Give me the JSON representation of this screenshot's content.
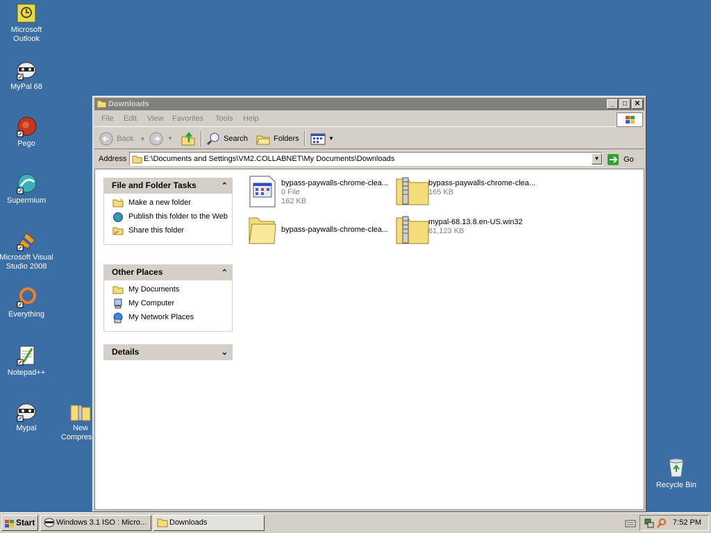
{
  "desktop": {
    "background": "#3a6ea5",
    "icons": [
      {
        "label": "Microsoft Outlook",
        "icon": "outlook-icon"
      },
      {
        "label": "MyPal 68",
        "icon": "mypal-icon"
      },
      {
        "label": "Pego",
        "icon": "pego-icon"
      },
      {
        "label": "Supermium",
        "icon": "supermium-icon"
      },
      {
        "label": "Microsoft Visual Studio 2008",
        "icon": "visual-studio-icon"
      },
      {
        "label": "Everything",
        "icon": "everything-icon"
      },
      {
        "label": "Notepad++",
        "icon": "notepad-plus-plus-icon"
      },
      {
        "label": "Mypal",
        "icon": "mypal-icon"
      },
      {
        "label": "New Compresse",
        "icon": "zip-folder-icon"
      },
      {
        "label": "Recycle Bin",
        "icon": "recycle-bin-icon"
      }
    ]
  },
  "window": {
    "title": "Downloads",
    "menus": [
      "File",
      "Edit",
      "View",
      "Favorites",
      "Tools",
      "Help"
    ],
    "toolbar": {
      "back": "Back",
      "search": "Search",
      "folders": "Folders"
    },
    "address": {
      "label": "Address",
      "value": "E:\\Documents and Settings\\VM2.COLLABNET\\My Documents\\Downloads",
      "go": "Go"
    },
    "panels": {
      "tasks": {
        "title": "File and Folder Tasks",
        "items": [
          "Make a new folder",
          "Publish this folder to the Web",
          "Share this folder"
        ]
      },
      "places": {
        "title": "Other Places",
        "items": [
          "My Documents",
          "My Computer",
          "My Network Places"
        ]
      },
      "details": {
        "title": "Details"
      }
    },
    "files": [
      {
        "name": "bypass-paywalls-chrome-clea...",
        "type": "0 File",
        "size": "162 KB",
        "icon": "file-icon"
      },
      {
        "name": "bypass-paywalls-chrome-clea...",
        "type": "",
        "size": "165 KB",
        "icon": "zip-folder-icon"
      },
      {
        "name": "bypass-paywalls-chrome-clea...",
        "type": "",
        "size": "",
        "icon": "folder-icon"
      },
      {
        "name": "mypal-68.13.8.en-US.win32",
        "type": "",
        "size": "61,123 KB",
        "icon": "zip-folder-icon"
      }
    ]
  },
  "taskbar": {
    "start": "Start",
    "tasks": [
      "Windows 3.1 ISO : Micro...",
      "Downloads"
    ],
    "clock": "7:52 PM"
  }
}
